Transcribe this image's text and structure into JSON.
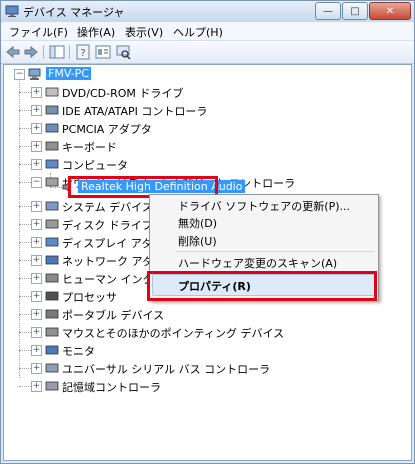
{
  "window": {
    "title": "デバイス マネージャ"
  },
  "menu": [
    {
      "label": "ファイル(F)"
    },
    {
      "label": "操作(A)"
    },
    {
      "label": "表示(V)"
    },
    {
      "label": "ヘルプ(H)"
    }
  ],
  "window_buttons": {
    "minimize": "—",
    "maximize": "□",
    "close": "✕"
  },
  "tree": {
    "root": "FMV-PC",
    "items": [
      {
        "label": "DVD/CD-ROM ドライブ",
        "icon": "dvd-icon"
      },
      {
        "label": "IDE ATA/ATAPI コントローラ",
        "icon": "ide-controller-icon"
      },
      {
        "label": "PCMCIA アダプタ",
        "icon": "pcmcia-icon"
      },
      {
        "label": "キーボード",
        "icon": "keyboard-icon"
      },
      {
        "label": "コンピュータ",
        "icon": "computer-icon"
      },
      {
        "label": "サウンド、ビデオ、およびゲーム コントローラ",
        "icon": "sound-icon"
      },
      {
        "label": "システム デバイス",
        "icon": "system-device-icon"
      },
      {
        "label": "ディスク ドライブ",
        "icon": "disk-drive-icon"
      },
      {
        "label": "ディスプレイ アダプタ",
        "icon": "display-adapter-icon"
      },
      {
        "label": "ネットワーク アダプタ",
        "icon": "network-adapter-icon"
      },
      {
        "label": "ヒューマン インターフェイス デバイス",
        "icon": "hid-icon"
      },
      {
        "label": "プロセッサ",
        "icon": "processor-icon"
      },
      {
        "label": "ポータブル デバイス",
        "icon": "portable-device-icon"
      },
      {
        "label": "マウスとそのほかのポインティング デバイス",
        "icon": "mouse-icon"
      },
      {
        "label": "モニタ",
        "icon": "monitor-icon"
      },
      {
        "label": "ユニバーサル シリアル バス コントローラ",
        "icon": "usb-icon"
      },
      {
        "label": "記憶域コントローラ",
        "icon": "storage-controller-icon"
      }
    ],
    "selected_child": "Realtek High Definition Audio"
  },
  "context_menu": {
    "items": [
      {
        "label": "ドライバ ソフトウェアの更新(P)..."
      },
      {
        "label": "無効(D)"
      },
      {
        "label": "削除(U)"
      },
      {
        "label": "ハードウェア変更のスキャン(A)"
      },
      {
        "label": "プロパティ(R)"
      }
    ]
  },
  "colors": {
    "highlight": "#e60012",
    "selection": "#3399ff"
  }
}
